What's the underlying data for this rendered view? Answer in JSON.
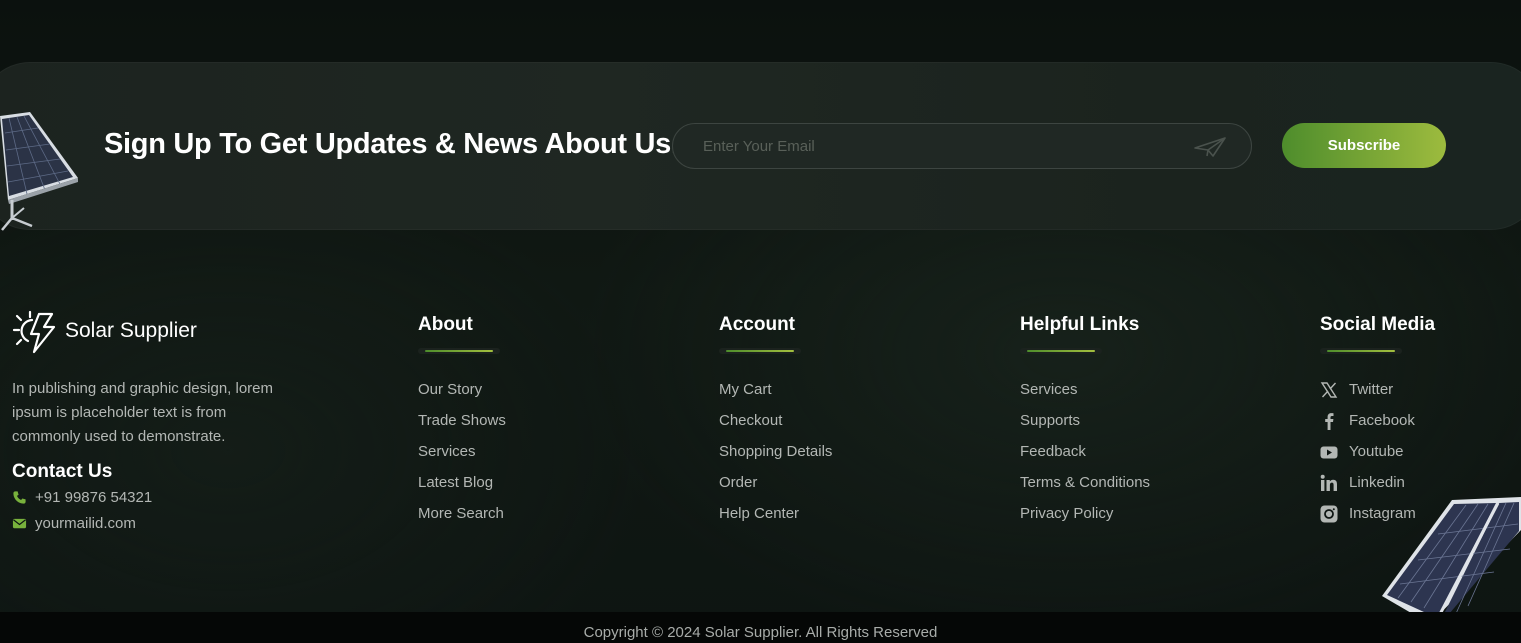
{
  "signup": {
    "title": "Sign Up To Get Updates & News About Us..",
    "email_placeholder": "Enter Your Email",
    "subscribe_label": "Subscribe"
  },
  "brand": {
    "name": "Solar Supplier",
    "description": "In publishing and graphic design, lorem ipsum is placeholder text is from commonly used to demonstrate."
  },
  "contact": {
    "title": "Contact Us",
    "phone": "+91 99876 54321",
    "email": "yourmailid.com"
  },
  "columns": {
    "about": {
      "title": "About",
      "items": [
        "Our Story",
        "Trade Shows",
        "Services",
        "Latest Blog",
        "More Search"
      ]
    },
    "account": {
      "title": "Account",
      "items": [
        "My Cart",
        "Checkout",
        "Shopping Details",
        "Order",
        "Help Center"
      ]
    },
    "helpful": {
      "title": "Helpful Links",
      "items": [
        "Services",
        "Supports",
        "Feedback",
        "Terms & Conditions",
        "Privacy Policy"
      ]
    },
    "social": {
      "title": "Social Media",
      "items": [
        {
          "label": "Twitter",
          "icon": "x-twitter-icon"
        },
        {
          "label": "Facebook",
          "icon": "facebook-icon"
        },
        {
          "label": "Youtube",
          "icon": "youtube-icon"
        },
        {
          "label": "Linkedin",
          "icon": "linkedin-icon"
        },
        {
          "label": "Instagram",
          "icon": "instagram-icon"
        }
      ]
    }
  },
  "footer": {
    "copyright": "Copyright © 2024 Solar Supplier. All Rights Reserved"
  },
  "colors": {
    "accent_start": "#4e8d2c",
    "accent_end": "#a3bf3f",
    "background": "#0e1512",
    "muted_text": "#b3b7b4"
  }
}
